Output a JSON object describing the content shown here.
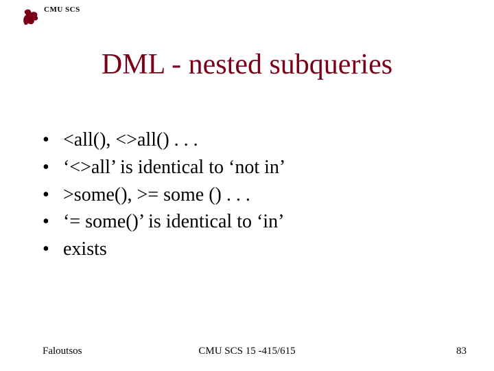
{
  "header": {
    "label": "CMU SCS"
  },
  "title": "DML - nested subqueries",
  "bullets": [
    "<all(), <>all() . . .",
    "‘<>all’  is identical to ‘not in’",
    ">some(), >= some () . . .",
    "‘= some()’ is identical to ‘in’",
    "exists"
  ],
  "footer": {
    "left": "Faloutsos",
    "center": "CMU SCS 15 -415/615",
    "right": "83"
  }
}
